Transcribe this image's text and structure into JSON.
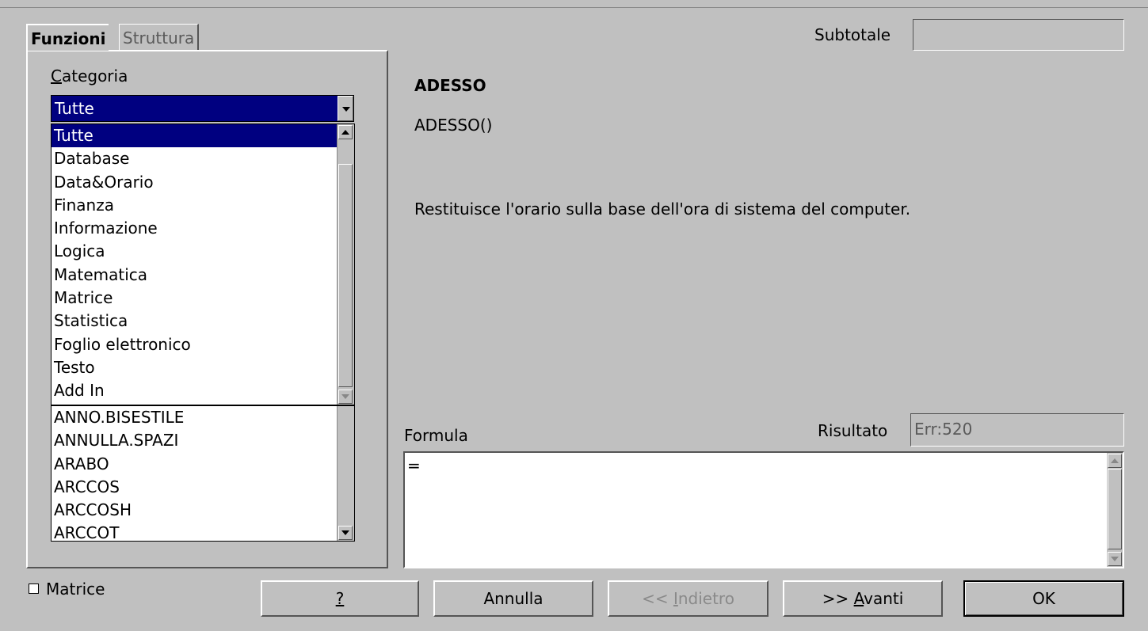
{
  "tabs": [
    {
      "label": "Funzioni",
      "active": true
    },
    {
      "label": "Struttura",
      "active": false
    }
  ],
  "category": {
    "label": "Categoria",
    "accelerator": "C",
    "label_rest": "ategoria",
    "selected": "Tutte",
    "options": [
      "Tutte",
      "Database",
      "Data&Orario",
      "Finanza",
      "Informazione",
      "Logica",
      "Matematica",
      "Matrice",
      "Statistica",
      "Foglio elettronico",
      "Testo",
      "Add In"
    ]
  },
  "functions": [
    "ANNO.BISESTILE",
    "ANNULLA.SPAZI",
    "ARABO",
    "ARCCOS",
    "ARCCOSH",
    "ARCCOT"
  ],
  "subtotal": {
    "label": "Subtotale",
    "value": ""
  },
  "details": {
    "name": "ADESSO",
    "signature": "ADESSO()",
    "description": "Restituisce l'orario sulla base dell'ora di sistema del computer."
  },
  "formula": {
    "label": "Formula",
    "value": "="
  },
  "result": {
    "label": "Risultato",
    "value": "Err:520"
  },
  "matrix": {
    "label": "Matrice",
    "checked": false
  },
  "buttons": {
    "help": {
      "label": "?"
    },
    "cancel": {
      "label": "Annulla"
    },
    "back": {
      "prefix": "<< ",
      "accel": "I",
      "rest": "ndietro"
    },
    "next": {
      "prefix": ">> ",
      "accel": "A",
      "rest": "vanti"
    },
    "ok": {
      "label": "OK"
    }
  },
  "colors": {
    "selection": "#000080",
    "face": "#c0c0c0"
  }
}
